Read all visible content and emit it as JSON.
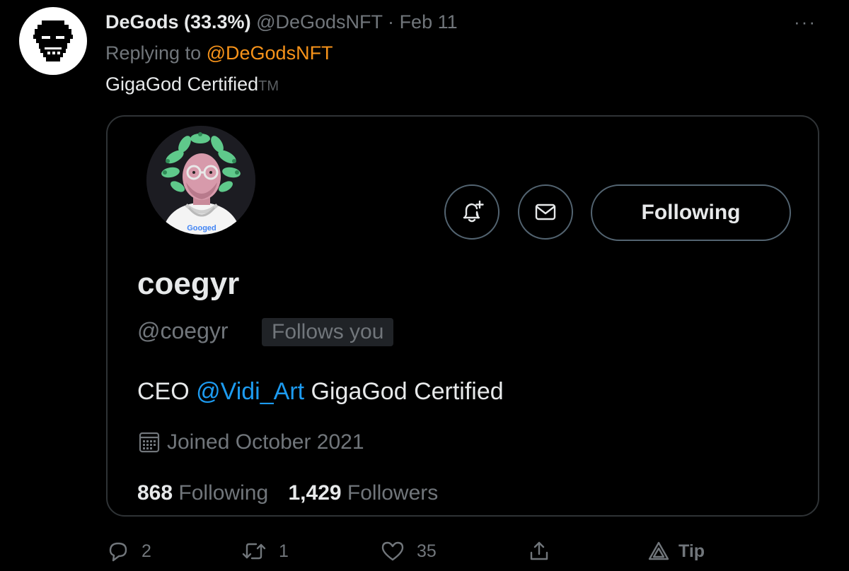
{
  "tweet": {
    "author_name": "DeGods (33.3%)",
    "author_handle": "@DeGodsNFT",
    "separator": "·",
    "date": "Feb 11",
    "more": "···",
    "reply_prefix": "Replying to",
    "reply_handle": "@DeGodsNFT",
    "text": "GigaGod Certified",
    "tm": "TM"
  },
  "profile_card": {
    "name": "coegyr",
    "handle": "@coegyr",
    "follows_you": "Follows you",
    "following_button": "Following",
    "bio_prefix": "CEO",
    "bio_mention": "@Vidi_Art",
    "bio_suffix": "GigaGod Certified",
    "joined": "Joined October 2021",
    "following_count": "868",
    "following_label": "Following",
    "followers_count": "1,429",
    "followers_label": "Followers",
    "shirt_text": "Googed"
  },
  "actions": {
    "replies": "2",
    "retweets": "1",
    "likes": "35",
    "tip_label": "Tip"
  },
  "colors": {
    "background": "#000000",
    "text_primary": "#e7e9ea",
    "text_secondary": "#71767b",
    "reply_handle": "#f7931a",
    "mention": "#1d9bf0",
    "border": "#2f3336"
  },
  "icons": {
    "more": "more-dots-icon",
    "notify": "bell-plus-icon",
    "message": "envelope-icon",
    "calendar": "calendar-icon",
    "reply": "speech-bubble-icon",
    "retweet": "retweet-arrows-icon",
    "like": "heart-icon",
    "share": "share-upload-icon",
    "tip": "tip-triangle-icon"
  }
}
